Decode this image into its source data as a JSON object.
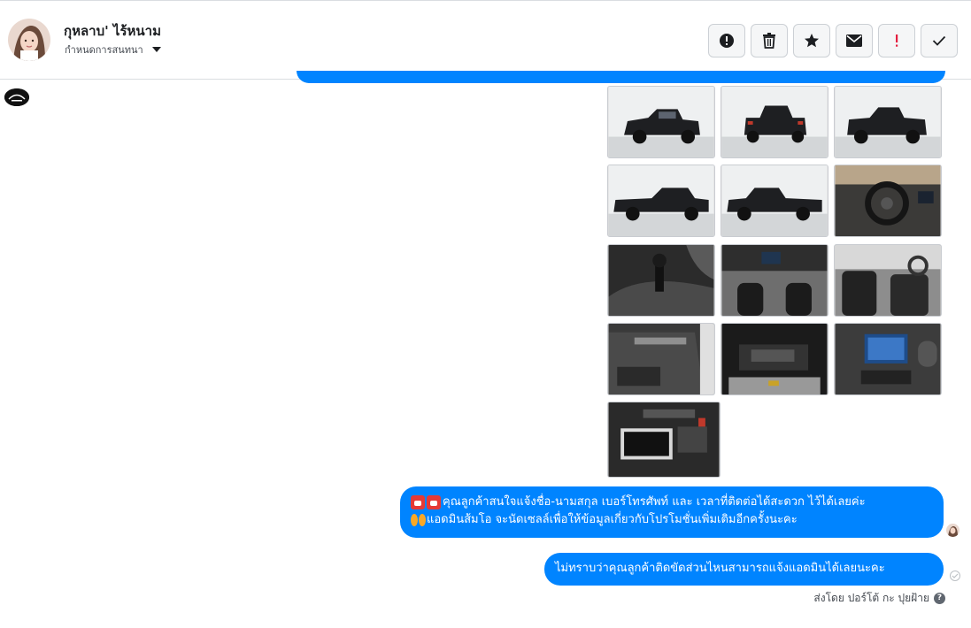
{
  "header": {
    "contact_name": "กุหลาบ' ไร้หนาม",
    "assign_label": "กำหนดการสนทนา",
    "toolbar": [
      {
        "name": "report-spam-button",
        "icon": "alert-circle-icon"
      },
      {
        "name": "delete-button",
        "icon": "trash-icon"
      },
      {
        "name": "star-button",
        "icon": "star-icon"
      },
      {
        "name": "mark-unread-button",
        "icon": "envelope-icon"
      },
      {
        "name": "follow-up-button",
        "icon": "exclamation-icon"
      },
      {
        "name": "mark-done-button",
        "icon": "checkmark-icon"
      }
    ]
  },
  "gallery": {
    "images": [
      {
        "icon": "truck-front-three-quarter-photo"
      },
      {
        "icon": "truck-rear-photo"
      },
      {
        "icon": "truck-rear-three-quarter-photo"
      },
      {
        "icon": "truck-side-photo"
      },
      {
        "icon": "truck-side-photo"
      },
      {
        "icon": "steering-wheel-photo"
      },
      {
        "icon": "gear-shift-photo"
      },
      {
        "icon": "dashboard-photo"
      },
      {
        "icon": "seats-photo"
      },
      {
        "icon": "door-panel-photo"
      },
      {
        "icon": "engine-bay-photo"
      },
      {
        "icon": "infotainment-screen-photo"
      },
      {
        "icon": "battery-engine-photo"
      }
    ]
  },
  "messages": [
    {
      "line1": "คุณลูกค้าสนใจแจ้งชื่อ-นามสกุล เบอร์โทรศัพท์ และ เวลาที่ติดต่อได้สะดวก ไว้ได้เลยค่ะ",
      "line2": "แอดมินส้มโอ จะนัดเซลล์เพื่อให้ข้อมูลเกี่ยวกับโปรโมชั่นเพิ่มเติมอีกครั้งนะคะ"
    },
    {
      "line1": "ไม่ทราบว่าคุณลูกค้าติดขัดส่วนไหนสามารถแจ้งแอดมินได้เลยนะคะ"
    }
  ],
  "footer": {
    "sent_by": "ส่งโดย ปอร์โต้ กะ ปุยฝ้าย"
  },
  "colors": {
    "bubble": "#0084ff",
    "follow_up_icon": "#e41e3f"
  }
}
